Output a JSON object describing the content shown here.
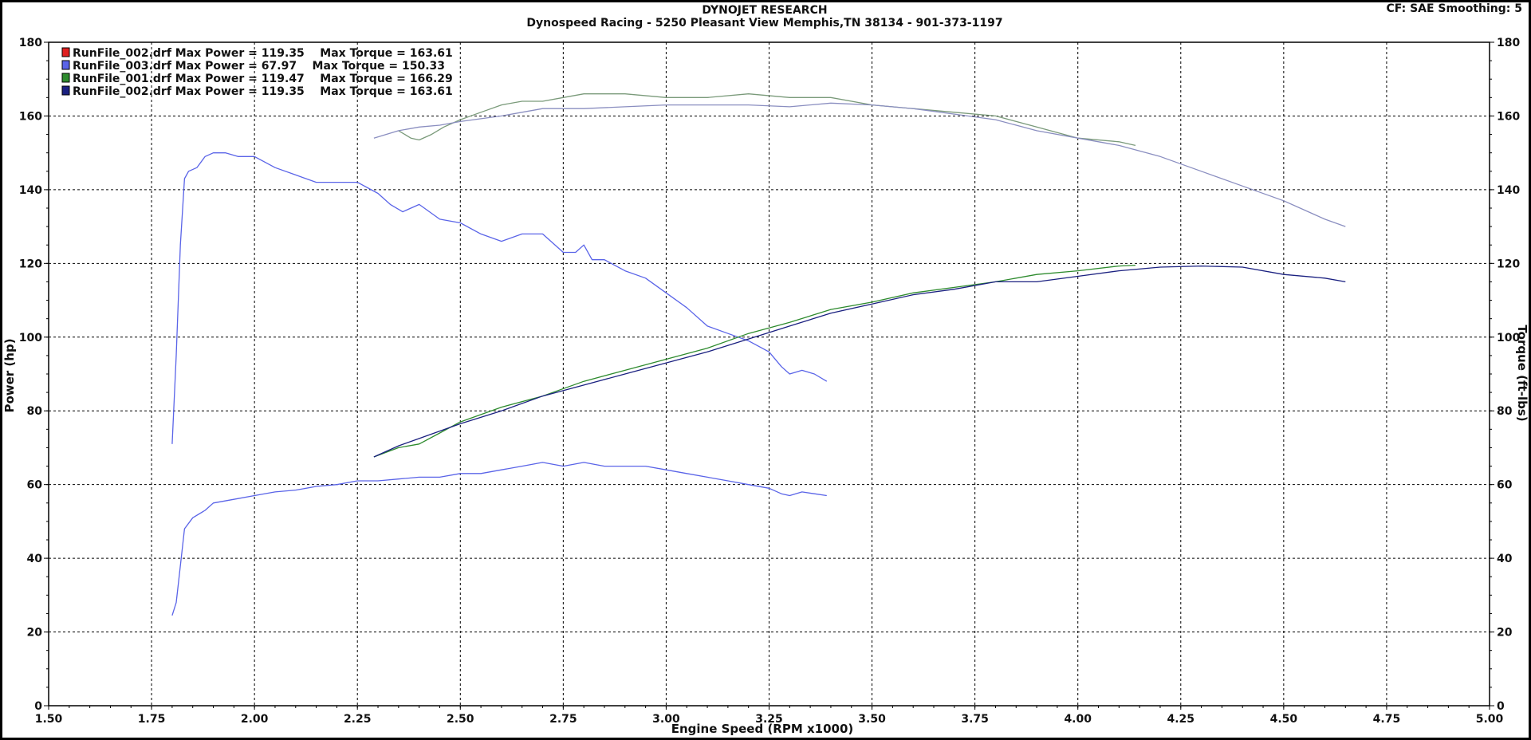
{
  "header": {
    "title": "DYNOJET RESEARCH",
    "subtitle": "Dynospeed  Racing - 5250 Pleasant View Memphis,TN 38134 - 901-373-1197",
    "settings": "CF: SAE  Smoothing: 5"
  },
  "chart_data": {
    "type": "line",
    "xlabel": "Engine Speed (RPM x1000)",
    "ylabel": "Power (hp)",
    "y2label": "Torque (ft-lbs)",
    "xlim": [
      1.5,
      5.0
    ],
    "ylim": [
      0,
      180
    ],
    "y2lim": [
      0,
      180
    ],
    "xticks": [
      "1.50",
      "1.75",
      "2.00",
      "2.25",
      "2.50",
      "2.75",
      "3.00",
      "3.25",
      "3.50",
      "3.75",
      "4.00",
      "4.25",
      "4.50",
      "4.75",
      "5.00"
    ],
    "yticks": [
      "0",
      "20",
      "40",
      "60",
      "80",
      "100",
      "120",
      "140",
      "160",
      "180"
    ],
    "grid": true,
    "legend_position": "top-left",
    "legend": [
      {
        "text": "RunFile_002.drf Max Power = 119.35    Max Torque = 163.61",
        "color": "#e02020"
      },
      {
        "text": "RunFile_003.drf Max Power = 67.97    Max Torque = 150.33",
        "color": "#5a64e8"
      },
      {
        "text": "RunFile_001.drf Max Power = 119.47    Max Torque = 166.29",
        "color": "#2e8b2e"
      },
      {
        "text": "RunFile_002.drf Max Power = 119.35    Max Torque = 163.61",
        "color": "#1a2080"
      }
    ],
    "series": [
      {
        "kind": "torque",
        "color": "#5a64e8",
        "x": [
          1.8,
          1.81,
          1.82,
          1.83,
          1.84,
          1.86,
          1.88,
          1.9,
          1.93,
          1.96,
          2.0,
          2.05,
          2.1,
          2.15,
          2.2,
          2.25,
          2.3,
          2.33,
          2.36,
          2.4,
          2.45,
          2.5,
          2.55,
          2.6,
          2.65,
          2.7,
          2.75,
          2.78,
          2.8,
          2.82,
          2.85,
          2.9,
          2.95,
          3.0,
          3.05,
          3.1,
          3.15,
          3.2,
          3.25,
          3.28,
          3.3,
          3.33,
          3.36,
          3.39
        ],
        "y": [
          71,
          95,
          125,
          143,
          145,
          146,
          149,
          150,
          150,
          149,
          149,
          146,
          144,
          142,
          142,
          142,
          139,
          136,
          134,
          136,
          132,
          131,
          128,
          126,
          128,
          128,
          123,
          123,
          125,
          121,
          121,
          118,
          116,
          112,
          108,
          103,
          101,
          99,
          96,
          92,
          90,
          91,
          90,
          88
        ]
      },
      {
        "kind": "power",
        "color": "#5a64e8",
        "x": [
          1.8,
          1.81,
          1.82,
          1.83,
          1.85,
          1.88,
          1.9,
          1.95,
          2.0,
          2.05,
          2.1,
          2.15,
          2.2,
          2.25,
          2.3,
          2.35,
          2.4,
          2.45,
          2.5,
          2.55,
          2.6,
          2.65,
          2.7,
          2.75,
          2.8,
          2.85,
          2.9,
          2.95,
          3.0,
          3.05,
          3.1,
          3.15,
          3.2,
          3.25,
          3.28,
          3.3,
          3.33,
          3.36,
          3.39
        ],
        "y": [
          24.5,
          28,
          38,
          48,
          51,
          53,
          55,
          56,
          57,
          58,
          58.5,
          59.5,
          60,
          61,
          61,
          61.5,
          62,
          62,
          63,
          63,
          64,
          65,
          66,
          65,
          66,
          65,
          65,
          65,
          64,
          63,
          62,
          61,
          60,
          59,
          57.5,
          57,
          58,
          57.5,
          57
        ]
      },
      {
        "kind": "torque",
        "color": "#7a9a7a",
        "x": [
          2.35,
          2.38,
          2.4,
          2.43,
          2.46,
          2.5,
          2.55,
          2.6,
          2.65,
          2.7,
          2.75,
          2.8,
          2.9,
          3.0,
          3.1,
          3.2,
          3.3,
          3.4,
          3.5,
          3.6,
          3.7,
          3.8,
          3.9,
          4.0,
          4.1,
          4.14
        ],
        "y": [
          156,
          154,
          153.5,
          155,
          157,
          159,
          161,
          163,
          164,
          164,
          165,
          166,
          166,
          165,
          165,
          166,
          165,
          165,
          163,
          162,
          161,
          160,
          157,
          154,
          153,
          152
        ]
      },
      {
        "kind": "torque",
        "color": "#8a8ec0",
        "x": [
          2.29,
          2.35,
          2.4,
          2.45,
          2.5,
          2.6,
          2.7,
          2.8,
          2.9,
          3.0,
          3.1,
          3.2,
          3.3,
          3.4,
          3.5,
          3.6,
          3.7,
          3.8,
          3.9,
          4.0,
          4.1,
          4.2,
          4.3,
          4.4,
          4.5,
          4.6,
          4.65
        ],
        "y": [
          154,
          156,
          157,
          157.5,
          158.5,
          160,
          162,
          162,
          162.5,
          163,
          163,
          163,
          162.5,
          163.5,
          163,
          162,
          160.5,
          159,
          156,
          154,
          152,
          149,
          145,
          141,
          137,
          132,
          130
        ]
      },
      {
        "kind": "power",
        "color": "#2e8b2e",
        "x": [
          2.29,
          2.35,
          2.4,
          2.45,
          2.5,
          2.6,
          2.7,
          2.8,
          2.9,
          3.0,
          3.1,
          3.2,
          3.3,
          3.4,
          3.5,
          3.6,
          3.7,
          3.8,
          3.9,
          4.0,
          4.1,
          4.14
        ],
        "y": [
          67.5,
          70,
          71,
          74,
          77,
          81,
          84,
          88,
          91,
          94,
          97,
          101,
          104,
          107.5,
          109.5,
          112,
          113.5,
          115,
          117,
          118,
          119.3,
          119.5
        ]
      },
      {
        "kind": "power",
        "color": "#1a2080",
        "x": [
          2.29,
          2.35,
          2.4,
          2.45,
          2.5,
          2.6,
          2.7,
          2.8,
          2.9,
          3.0,
          3.1,
          3.2,
          3.3,
          3.4,
          3.5,
          3.6,
          3.7,
          3.8,
          3.9,
          4.0,
          4.1,
          4.2,
          4.3,
          4.4,
          4.5,
          4.6,
          4.65
        ],
        "y": [
          67.5,
          70.5,
          72.5,
          74.5,
          76.5,
          80,
          84,
          87,
          90,
          93,
          96,
          99.5,
          103,
          106.5,
          109,
          111.5,
          113,
          115,
          115,
          116.5,
          118,
          119,
          119.3,
          119,
          117,
          116,
          115
        ]
      }
    ]
  }
}
